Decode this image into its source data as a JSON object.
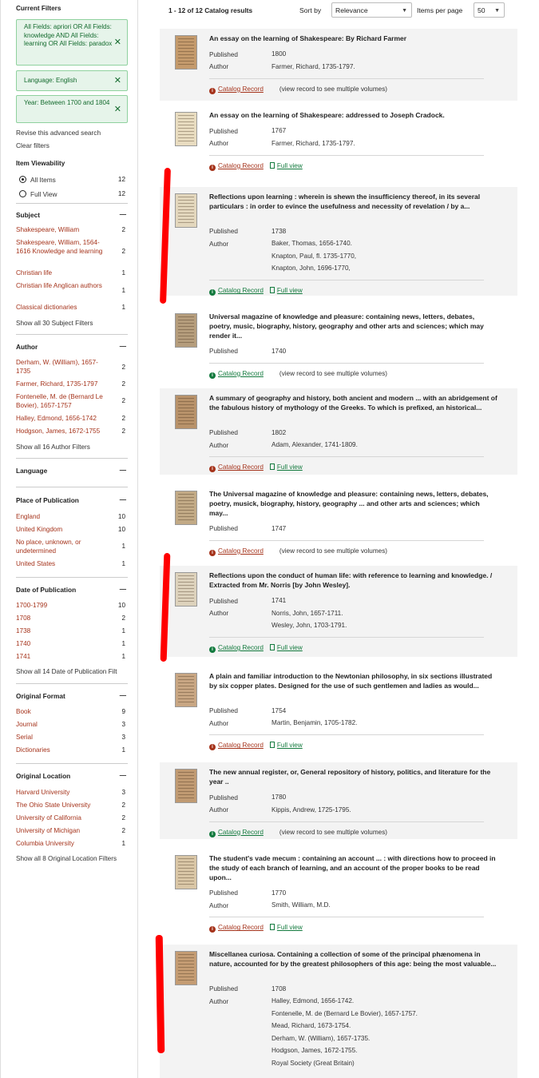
{
  "sidebar": {
    "current_filters_title": "Current Filters",
    "chips": [
      {
        "text": "All Fields: apriori OR All Fields: knowledge AND All Fields: learning OR All Fields: paradox",
        "close": "✕"
      },
      {
        "text": "Language: English",
        "close": "✕"
      },
      {
        "text": "Year: Between 1700 and 1804",
        "close": "✕"
      }
    ],
    "revise_link": "Revise this advanced search",
    "clear_link": "Clear filters",
    "viewability": {
      "title": "Item Viewability",
      "options": [
        {
          "label": "All Items",
          "count": "12",
          "selected": true
        },
        {
          "label": "Full View",
          "count": "12",
          "selected": false
        }
      ]
    },
    "subject": {
      "title": "Subject",
      "toggle": "—",
      "items": [
        {
          "label": "Shakespeare, William",
          "count": "2"
        },
        {
          "label": "Shakespeare, William, 1564-1616 Knowledge and learning",
          "count": "2"
        },
        {
          "label": "Christian life",
          "count": "1"
        },
        {
          "label": "Christian life Anglican authors",
          "count": "1"
        },
        {
          "label": "Classical dictionaries",
          "count": "1"
        }
      ],
      "show_all": "Show all 30 Subject Filters"
    },
    "author": {
      "title": "Author",
      "toggle": "—",
      "items": [
        {
          "label": "Derham, W. (William), 1657-1735",
          "count": "2"
        },
        {
          "label": "Farmer, Richard, 1735-1797",
          "count": "2"
        },
        {
          "label": "Fontenelle, M. de (Bernard Le Bovier), 1657-1757",
          "count": "2"
        },
        {
          "label": "Halley, Edmond, 1656-1742",
          "count": "2"
        },
        {
          "label": "Hodgson, James, 1672-1755",
          "count": "2"
        }
      ],
      "show_all": "Show all 16 Author Filters"
    },
    "language": {
      "title": "Language",
      "toggle": "—"
    },
    "place": {
      "title": "Place of Publication",
      "toggle": "—",
      "items": [
        {
          "label": "England",
          "count": "10"
        },
        {
          "label": "United Kingdom",
          "count": "10"
        },
        {
          "label": "No place, unknown, or undetermined",
          "count": "1"
        },
        {
          "label": "United States",
          "count": "1"
        }
      ]
    },
    "date": {
      "title": "Date of Publication",
      "toggle": "—",
      "items": [
        {
          "label": "1700-1799",
          "count": "10"
        },
        {
          "label": "1708",
          "count": "2"
        },
        {
          "label": "1738",
          "count": "1"
        },
        {
          "label": "1740",
          "count": "1"
        },
        {
          "label": "1741",
          "count": "1"
        }
      ],
      "show_all": "Show all 14 Date of Publication Filt"
    },
    "format": {
      "title": "Original Format",
      "toggle": "—",
      "items": [
        {
          "label": "Book",
          "count": "9"
        },
        {
          "label": "Journal",
          "count": "3"
        },
        {
          "label": "Serial",
          "count": "3"
        },
        {
          "label": "Dictionaries",
          "count": "1"
        }
      ]
    },
    "location": {
      "title": "Original Location",
      "toggle": "—",
      "items": [
        {
          "label": "Harvard University",
          "count": "3"
        },
        {
          "label": "The Ohio State University",
          "count": "2"
        },
        {
          "label": "University of California",
          "count": "2"
        },
        {
          "label": "University of Michigan",
          "count": "2"
        },
        {
          "label": "Columbia University",
          "count": "1"
        }
      ],
      "show_all": "Show all 8 Original Location Filters"
    }
  },
  "toolbar": {
    "results": "1 - 12 of 12 Catalog results",
    "sort_label": "Sort by",
    "sort_value": "Relevance",
    "per_page_label": "Items per page",
    "per_page_value": "50"
  },
  "labels": {
    "published": "Published",
    "author": "Author",
    "catalog_record": "Catalog Record",
    "full_view": "Full view",
    "multi": "(view record to see multiple volumes)",
    "info_icon": "i"
  },
  "results": [
    {
      "title": "An essay on the learning of Shakespeare: By Richard Farmer",
      "published": "1800",
      "authors": [
        "Farmer, Richard, 1735-1797."
      ],
      "link": "multi",
      "green": false
    },
    {
      "title": "An essay on the learning of Shakespeare: addressed to Joseph Cradock.",
      "published": "1767",
      "authors": [
        "Farmer, Richard, 1735-1797."
      ],
      "link": "full",
      "green": false
    },
    {
      "title": "Reflections upon learning : wherein is shewn the insufficiency thereof, in its several particulars : in order to evince the usefulness and necessity of revelation / by a...",
      "published": "1738",
      "authors": [
        "Baker, Thomas, 1656-1740.",
        "Knapton, Paul, fl. 1735-1770,",
        "Knapton, John, 1696-1770,"
      ],
      "link": "full",
      "green": true
    },
    {
      "title": "Universal magazine of knowledge and pleasure: containing news, letters, debates, poetry, music, biography, history, geography and other arts and sciences; which may render it...",
      "published": "1740",
      "authors": [],
      "link": "multi",
      "green": true
    },
    {
      "title": "A summary of geography and history, both ancient and modern ... with an abridgement of the fabulous history of mythology of the Greeks. To which is prefixed, an historical...",
      "published": "1802",
      "authors": [
        "Adam, Alexander, 1741-1809."
      ],
      "link": "full",
      "green": false
    },
    {
      "title": "The Universal magazine of knowledge and pleasure: containing news, letters, debates, poetry, musick, biography, history, geography ... and other arts and sciences; which may...",
      "published": "1747",
      "authors": [],
      "link": "multi",
      "green": false
    },
    {
      "title": "Reflections upon the conduct of human life: with reference to learning and knowledge. / Extracted from Mr. Norris [by John Wesley].",
      "published": "1741",
      "authors": [
        "Norris, John, 1657-1711.",
        "Wesley, John, 1703-1791."
      ],
      "link": "full",
      "green": true
    },
    {
      "title": "A plain and familiar introduction to the Newtonian philosophy, in six sections illustrated by six copper plates. Designed for the use of such gentlemen and ladies as would...",
      "published": "1754",
      "authors": [
        "Martin, Benjamin, 1705-1782."
      ],
      "link": "full",
      "green": false
    },
    {
      "title": "The new annual register, or, General repository of history, politics, and literature for the year ..",
      "published": "1780",
      "authors": [
        "Kippis, Andrew, 1725-1795."
      ],
      "link": "multi",
      "green": true
    },
    {
      "title": "The student's vade mecum : containing an account ... : with directions how to proceed in the study of each branch of learning, and an account of the proper books to be read upon...",
      "published": "1770",
      "authors": [
        "Smith, William, M.D."
      ],
      "link": "full",
      "green": false
    },
    {
      "title": "Miscellanea curiosa. Containing a collection of some of the principal phænomena in nature, accounted for by the greatest philosophers of this age: being the most valuable...",
      "published": "1708",
      "authors": [
        "Halley, Edmond, 1656-1742.",
        "Fontenelle, M. de (Bernard Le Bovier), 1657-1757.",
        "Mead, Richard, 1673-1754.",
        "Derham, W. (William), 1657-1735.",
        "Hodgson, James, 1672-1755.",
        "Royal Society (Great Britain)"
      ],
      "link": "none",
      "green": false
    }
  ]
}
